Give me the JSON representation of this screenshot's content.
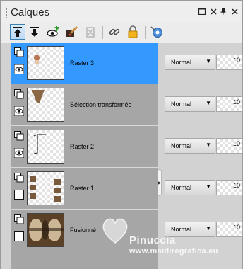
{
  "panel": {
    "title": "Calques"
  },
  "window_controls": [
    "restore-icon",
    "close-icon",
    "pin-icon",
    "close-panel-icon"
  ],
  "toolbar": {
    "tools": [
      {
        "name": "move-layer-up-icon",
        "active": true
      },
      {
        "name": "move-layer-down-icon",
        "active": false
      },
      {
        "name": "toggle-visibility-icon",
        "active": false
      },
      {
        "name": "brush-properties-icon",
        "active": false
      },
      {
        "name": "delete-layer-icon",
        "active": false
      },
      {
        "name": "link-layer-icon",
        "active": false
      },
      {
        "name": "lock-layer-icon",
        "active": false
      },
      {
        "name": "mask-icon",
        "active": false
      }
    ]
  },
  "layers": [
    {
      "name": "Raster 3",
      "blend": "Normal",
      "opacity": "10",
      "selected": true,
      "visible": true
    },
    {
      "name": "Sélection transformée",
      "blend": "Normal",
      "opacity": "10",
      "selected": false,
      "visible": true
    },
    {
      "name": "Raster 2",
      "blend": "Normal",
      "opacity": "10",
      "selected": false,
      "visible": true
    },
    {
      "name": "Raster 1",
      "blend": "Normal",
      "opacity": "10",
      "selected": false,
      "visible": false
    },
    {
      "name": "Fusionné",
      "blend": "Normal",
      "opacity": "10",
      "selected": false,
      "visible": false
    }
  ],
  "watermark": {
    "line1": "Pinuccia",
    "line2": "www.maidiregrafica.eu"
  },
  "colors": {
    "selected_row": "#3399ff",
    "rows_bg": "#a6a6a6"
  }
}
